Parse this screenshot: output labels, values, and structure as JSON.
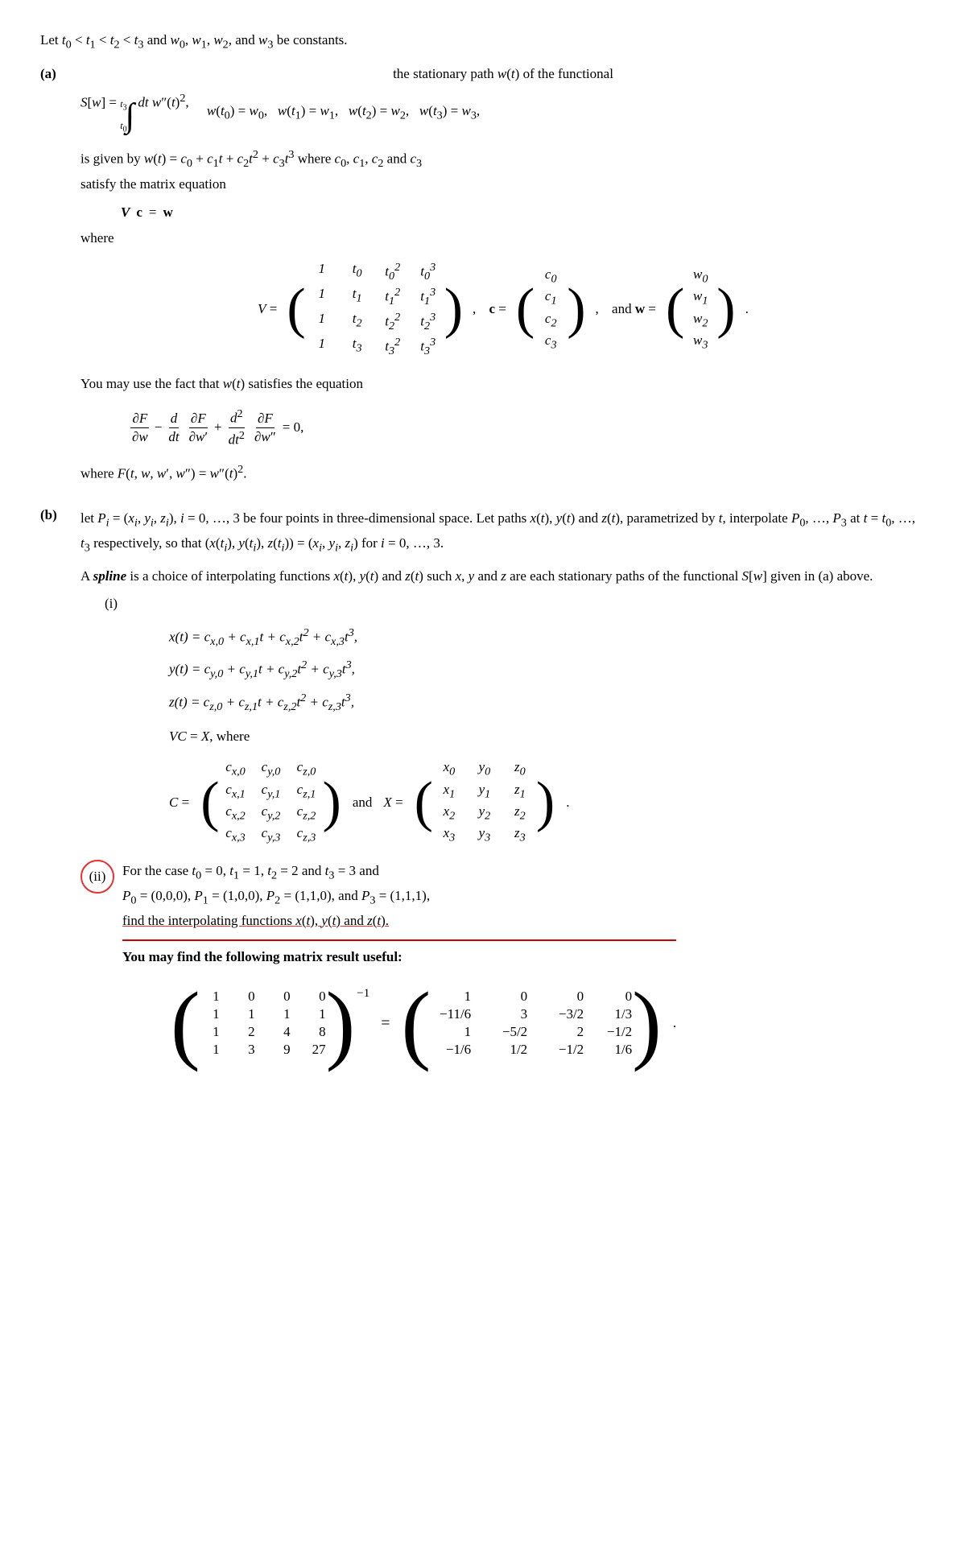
{
  "intro": "Let t₀ < t₁ < t₂ < t₃ and w₀, w₁, w₂, and w₃ be constants.",
  "part_a": {
    "label": "(a)",
    "title": "the stationary path w(t) of the functional",
    "integral_text": "S[w] = ∫ dt w″(t)²,",
    "conditions": "w(t₀) = w₀,   w(t₁) = w₁,   w(t₂) = w₂,   w(t₃) = w₃,",
    "given_text": "is given by w(t) = c₀ + c₁t + c₂t² + c₃t³ where c₀, c₁, c₂ and c₃",
    "satisfy_text": "satisfy the matrix equation",
    "vc_eq": "Vc = w",
    "where_text": "where",
    "V_label": "V =",
    "c_label": "c =",
    "and_text": "and",
    "w_label": "w =",
    "V_matrix": [
      [
        "1",
        "t₀",
        "t₀²",
        "t₀³"
      ],
      [
        "1",
        "t₁",
        "t₁²",
        "t₁³"
      ],
      [
        "1",
        "t₂",
        "t₂²",
        "t₂³"
      ],
      [
        "1",
        "t₃",
        "t₃²",
        "t₃³"
      ]
    ],
    "c_matrix": [
      "c₀",
      "c₁",
      "c₂",
      "c₃"
    ],
    "w_matrix": [
      "w₀",
      "w₁",
      "w₂",
      "w₃"
    ],
    "fact_text": "You may use the fact that w(t) satisfies the equation",
    "euler_eq": "∂F/∂w − d/dt · ∂F/∂w′ + d²/dt² · ∂F/∂w″ = 0,",
    "where_F": "where F(t, w, w′, w″) = w″(t)²."
  },
  "part_b": {
    "label": "(b)",
    "text": "let Pᵢ = (xᵢ, yᵢ, zᵢ), i = 0, …, 3 be four points in three-dimensional space. Let paths x(t), y(t) and z(t), parametrized by t, interpolate P₀, …, P₃ at t = t₀, …, t₃ respectively, so that (x(tᵢ), y(tᵢ), z(tᵢ)) = (xᵢ, yᵢ, zᵢ) for i = 0, …, 3.",
    "spline_text1": "A spline is a choice of interpolating functions x(t), y(t) and z(t) such x, y and z are each stationary paths of the functional S[w] given in (a) above.",
    "part_i": {
      "label": "(i)",
      "equations": [
        "x(t) = cₓ,₀ + cₓ,₁t + cₓ,₂t² + cₓ,₃t³,",
        "y(t) = c_y,₀ + c_y,₁t + c_y,₂t² + c_y,₃t³,",
        "z(t) = c_z,₀ + c_z,₁t + c_z,₂t² + c_z,₃t³,"
      ],
      "vc_eq": "VC = X, where",
      "C_matrix": [
        [
          "cₓ,₀",
          "c_y,₀",
          "c_z,₀"
        ],
        [
          "cₓ,₁",
          "c_y,₁",
          "c_z,₁"
        ],
        [
          "cₓ,₂",
          "c_y,₂",
          "c_z,₂"
        ],
        [
          "cₓ,₃",
          "c_y,₃",
          "c_z,₃"
        ]
      ],
      "and_text": "and",
      "X_matrix": [
        [
          "x₀",
          "y₀",
          "z₀"
        ],
        [
          "x₁",
          "y₁",
          "z₁"
        ],
        [
          "x₂",
          "y₂",
          "z₂"
        ],
        [
          "x₃",
          "y₃",
          "z₃"
        ]
      ]
    },
    "part_ii": {
      "label": "(ii)",
      "text": "For the case t₀ = 0, t₁ = 1, t₂ = 2 and t₃ = 3 and P₀ = (0,0,0), P₁ = (1,0,0), P₂ = (1,1,0), and P₃ = (1,1,1), find the interpolating functions x(t), y(t) and z(t).",
      "useful_text": "You may find the following matrix result useful:",
      "lhs_matrix": [
        [
          "1",
          "0",
          "0",
          "0"
        ],
        [
          "1",
          "1",
          "1",
          "1"
        ],
        [
          "1",
          "2",
          "4",
          "8"
        ],
        [
          "1",
          "3",
          "9",
          "27"
        ]
      ],
      "rhs_matrix": [
        [
          "1",
          "0",
          "0",
          "0"
        ],
        [
          "−11/6",
          "3",
          "−3/2",
          "1/3"
        ],
        [
          "1",
          "−5/2",
          "2",
          "−1/2"
        ],
        [
          "−1/6",
          "1/2",
          "−1/2",
          "1/6"
        ]
      ]
    }
  }
}
